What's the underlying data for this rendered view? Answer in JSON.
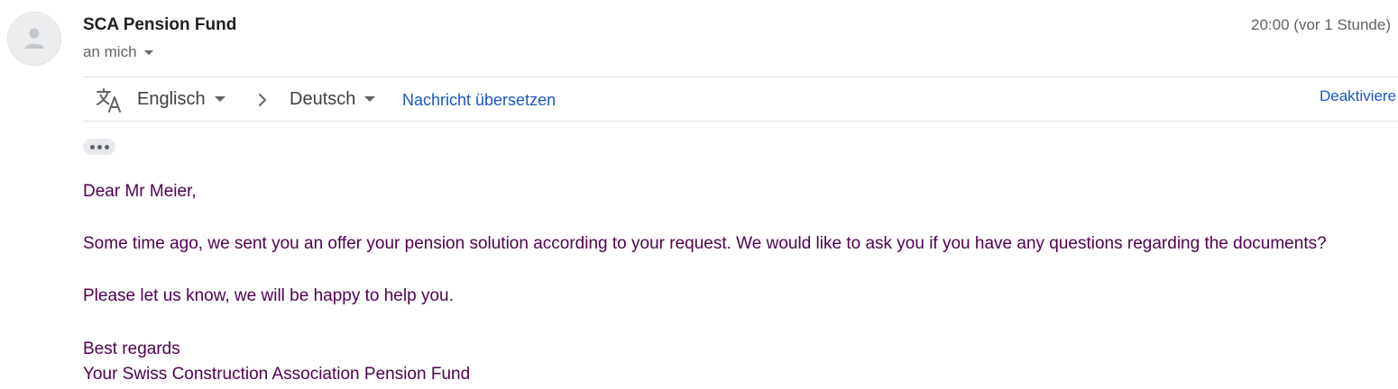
{
  "header": {
    "sender_name": "SCA Pension Fund",
    "recipient_label": "an mich",
    "timestamp": "20:00 (vor 1 Stunde)",
    "avatar_icon": "person-icon"
  },
  "translation_bar": {
    "icon": "translate-icon",
    "source_language": "Englisch",
    "arrow_icon": "chevron-right-icon",
    "target_language": "Deutsch",
    "translate_action": "Nachricht übersetzen",
    "deactivate_action": "Deaktiviere"
  },
  "trimmed_content_icon": "more-horizontal-icon",
  "message": {
    "greeting": "Dear Mr Meier,",
    "paragraph_1": "Some time ago, we sent you an offer your pension solution according to your request. We would like to ask you if you have any questions regarding the documents?",
    "paragraph_2": "Please let us know, we will be happy to help you.",
    "closing": "Best regards",
    "signature": "Your Swiss Construction Association Pension Fund"
  },
  "colors": {
    "body_text": "#500050",
    "link": "#1a57c9",
    "muted": "#5f6368"
  }
}
